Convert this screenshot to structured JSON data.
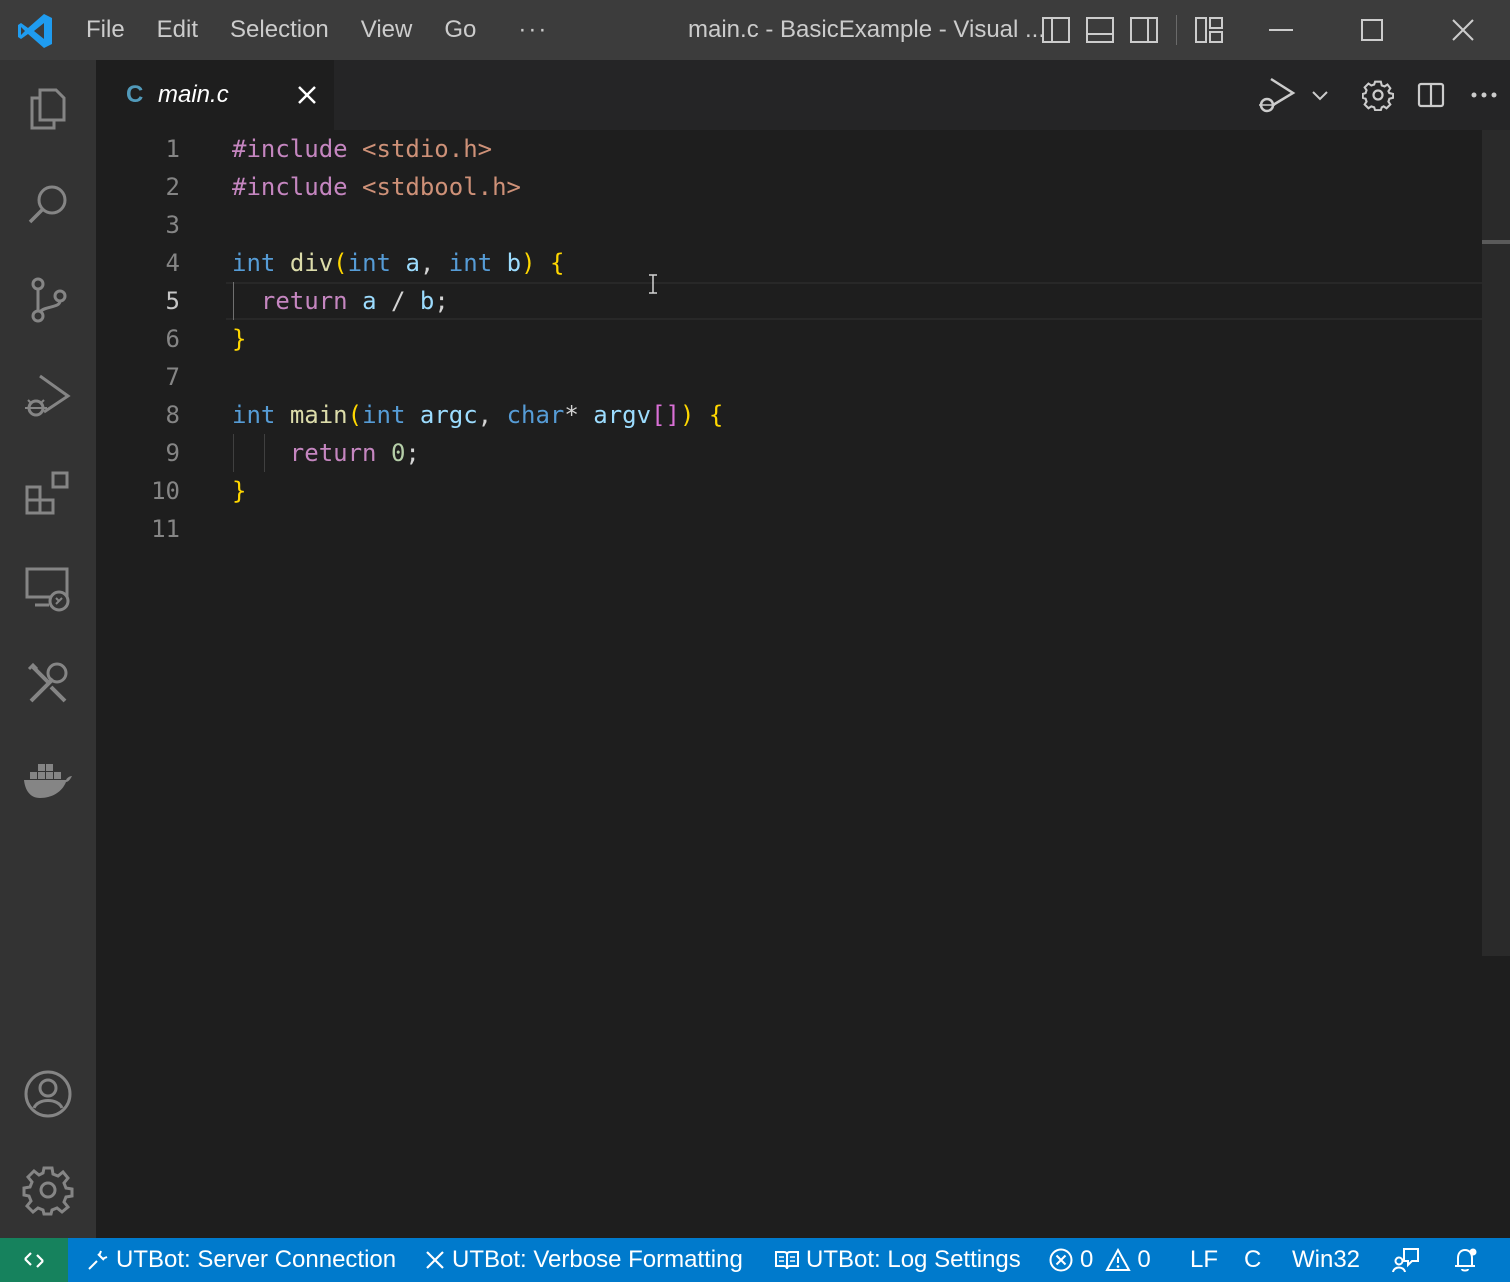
{
  "titlebar": {
    "menu": [
      "File",
      "Edit",
      "Selection",
      "View",
      "Go"
    ],
    "more": "···",
    "title": "main.c - BasicExample - Visual ..."
  },
  "activity_bar": {
    "items": [
      "explorer-icon",
      "search-icon",
      "source-control-icon",
      "run-debug-icon",
      "extensions-icon",
      "remote-explorer-icon",
      "utbot-tools-icon",
      "docker-icon"
    ],
    "bottom": [
      "account-icon",
      "manage-gear-icon"
    ]
  },
  "tab": {
    "icon_letter": "C",
    "name": "main.c"
  },
  "editor": {
    "line_numbers": [
      "1",
      "2",
      "3",
      "4",
      "5",
      "6",
      "7",
      "8",
      "9",
      "10",
      "11"
    ],
    "active_line": "5",
    "code": {
      "l1": {
        "directive": "#include",
        "header": "<stdio.h>"
      },
      "l2": {
        "directive": "#include",
        "header": "<stdbool.h>"
      },
      "l4": {
        "type1": "int",
        "fn": "div",
        "open_paren": "(",
        "type2": "int",
        "p1": "a",
        "comma": ",",
        "type3": "int",
        "p2": "b",
        "close_paren": ")",
        "brace": "{"
      },
      "l5": {
        "kw": "return",
        "a": "a",
        "op": "/",
        "b": "b",
        "semi": ";"
      },
      "l6": {
        "brace": "}"
      },
      "l8": {
        "type1": "int",
        "fn": "main",
        "open_paren": "(",
        "type2": "int",
        "p1": "argc",
        "comma": ",",
        "type3": "char",
        "star": "*",
        "p2": "argv",
        "brackets": "[]",
        "close_paren": ")",
        "brace": "{"
      },
      "l9": {
        "kw": "return",
        "num": "0",
        "semi": ";"
      },
      "l10": {
        "brace": "}"
      }
    }
  },
  "statusbar": {
    "server": "UTBot: Server Connection",
    "verbose": "UTBot: Verbose Formatting",
    "log": "UTBot: Log Settings",
    "errors": "0",
    "warnings": "0",
    "eol": "LF",
    "language": "C",
    "platform": "Win32"
  }
}
